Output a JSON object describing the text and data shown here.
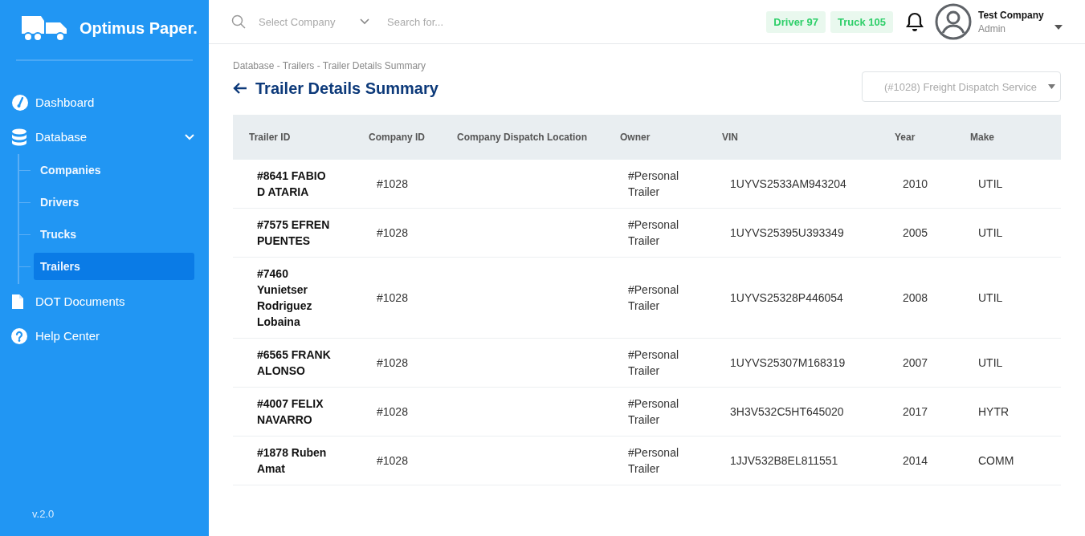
{
  "sidebar": {
    "brand": "Optimus Paper.",
    "items": [
      {
        "label": "Dashboard",
        "kind": "dashboard",
        "selected": false
      },
      {
        "label": "Database",
        "kind": "database",
        "selected": false,
        "expanded": true,
        "children": [
          {
            "label": "Companies",
            "selected": false
          },
          {
            "label": "Drivers",
            "selected": false
          },
          {
            "label": "Trucks",
            "selected": false
          },
          {
            "label": "Trailers",
            "selected": true
          }
        ]
      },
      {
        "label": "DOT Documents",
        "kind": "document",
        "selected": false
      },
      {
        "label": "Help Center",
        "kind": "help",
        "selected": false
      }
    ],
    "version": "v.2.0"
  },
  "topbar": {
    "company_select": {
      "placeholder": "Select Company"
    },
    "search": {
      "placeholder": "Search for..."
    },
    "badges": [
      "Driver 97",
      "Truck 105"
    ],
    "user": {
      "name": "Test Company",
      "role": "Admin"
    }
  },
  "breadcrumb": "Database - Trailers - Trailer Details Summary",
  "page_title": "Trailer Details Summary",
  "company_filter": {
    "placeholder": "(#1028) Freight Dispatch Service"
  },
  "table": {
    "columns": [
      "Trailer ID",
      "Company ID",
      "Company Dispatch Location",
      "Owner",
      "VIN",
      "Year",
      "Make"
    ],
    "rows": [
      [
        "#8641 FABIO D ATARIA",
        "#1028",
        "",
        "#Personal Trailer",
        "1UYVS2533AM943204",
        "2010",
        "UTIL"
      ],
      [
        "#7575 EFREN PUENTES",
        "#1028",
        "",
        "#Personal Trailer",
        "1UYVS25395U393349",
        "2005",
        "UTIL"
      ],
      [
        "#7460 Yunietser Rodriguez Lobaina",
        "#1028",
        "",
        "#Personal Trailer",
        "1UYVS25328P446054",
        "2008",
        "UTIL"
      ],
      [
        "#6565 FRANK ALONSO",
        "#1028",
        "",
        "#Personal Trailer",
        "1UYVS25307M168319",
        "2007",
        "UTIL"
      ],
      [
        "#4007 FELIX NAVARRO",
        "#1028",
        "",
        "#Personal Trailer",
        "3H3V532C5HT645020",
        "2017",
        "HYTR"
      ],
      [
        "#1878 Ruben Amat",
        "#1028",
        "",
        "#Personal Trailer",
        "1JJV532B8EL811551",
        "2014",
        "COMM"
      ]
    ]
  }
}
